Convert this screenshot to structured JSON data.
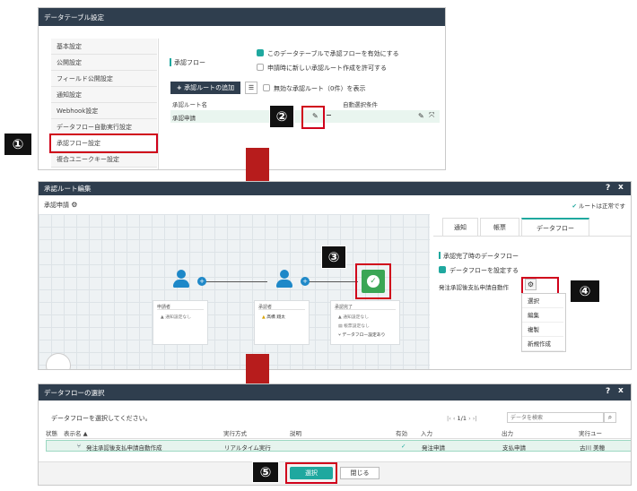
{
  "panel1": {
    "title": "データテーブル設定",
    "sidebar": [
      "基本設定",
      "公開設定",
      "フィールド公開設定",
      "通知設定",
      "Webhook設定",
      "データフロー自動実行設定",
      "承認フロー設定",
      "複合ユニークキー設定"
    ],
    "section_label": "承認フロー",
    "opt_enable": "このデータテーブルで承認フローを有効にする",
    "opt_allow_new": "申請時に新しい承認ルート作成を許可する",
    "add_route_btn": "承認ルートの追加",
    "show_invalid": "無効な承認ルート（0件）を表示",
    "col_route_name": "承認ルート名",
    "col_auto_cond": "自動選択条件",
    "row_route": "承認申請"
  },
  "panel2": {
    "title": "承認ルート編集",
    "help": "?",
    "close": "x",
    "route_name": "承認申請",
    "route_status": "ルートは正常です",
    "nodes": [
      {
        "title": "申請者",
        "rows": [
          "通知設定なし"
        ]
      },
      {
        "title": "承認者",
        "rows": [
          "高橋 翔太"
        ]
      },
      {
        "title": "承認完了",
        "rows": [
          "通知設定なし",
          "帳票設定なし",
          "データフロー設定あり"
        ]
      }
    ],
    "tabs": [
      "通知",
      "帳票",
      "データフロー"
    ],
    "df_heading": "承認完了時のデータフロー",
    "df_checkbox": "データフローを設定する",
    "df_value": "発注承認後支払申請自動作",
    "menu": [
      "選択",
      "編集",
      "複製",
      "新規作成"
    ]
  },
  "panel3": {
    "title": "データフローの選択",
    "help": "?",
    "close": "x",
    "instruction": "データフローを選択してください。",
    "pager": "1/1",
    "search_placeholder": "データを検索",
    "columns": [
      "状態",
      "表示名 ▲",
      "実行方式",
      "説明",
      "有効",
      "入力",
      "出力",
      "実行ユー"
    ],
    "row": {
      "name": "発注承認後支払申請自動作成",
      "mode": "リアルタイム実行",
      "valid": "✓",
      "input": "発注申請",
      "output": "支払申請",
      "user": "古川 美穂"
    },
    "select_btn": "選択",
    "close_btn": "閉じる"
  },
  "badges": [
    "①",
    "②",
    "③",
    "④",
    "⑤"
  ],
  "colors": {
    "accent": "#1fa89f",
    "titlebar": "#2f3e4e",
    "highlight": "#d0021b",
    "arrow": "#b71c1c"
  }
}
